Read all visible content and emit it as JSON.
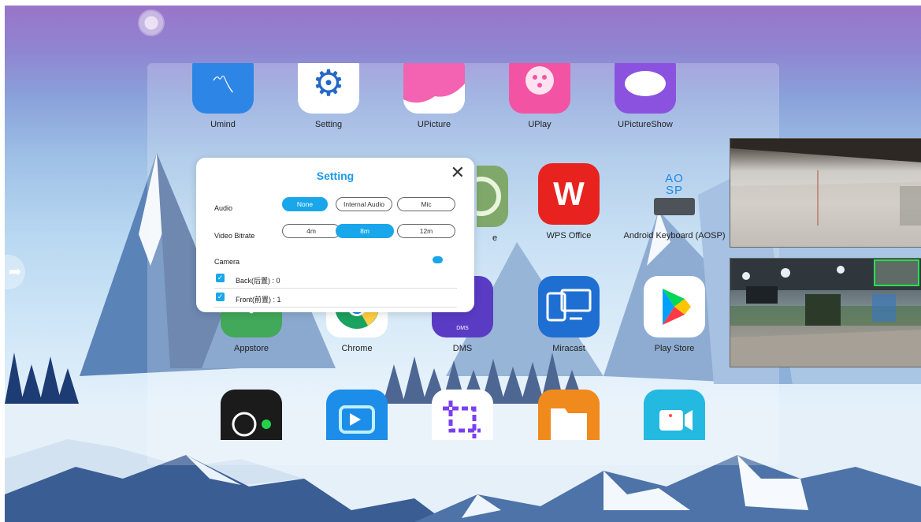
{
  "launcher": {
    "row1": [
      {
        "label": "Umind",
        "icon": "umind-icon",
        "color": "#2d86e6"
      },
      {
        "label": "Setting",
        "icon": "gear-icon",
        "color": "#2468c6"
      },
      {
        "label": "UPicture",
        "icon": "upicture-icon",
        "color": "#f462b2"
      },
      {
        "label": "UPlay",
        "icon": "uplay-icon",
        "color": "#f254a3"
      },
      {
        "label": "UPictureShow",
        "icon": "upictureshow-icon",
        "color": "#8b52e0"
      }
    ],
    "row2": [
      {
        "label": "WPS Office",
        "icon": "wps-office-icon",
        "color": "#e8231f"
      },
      {
        "label": "Android Keyboard (AOSP)",
        "icon": "keyboard-icon",
        "color": "#3a3f44"
      }
    ],
    "row2_partial_label": "e",
    "row3": [
      {
        "label": "Appstore",
        "icon": "appstore-icon",
        "color": "#42a85a"
      },
      {
        "label": "Chrome",
        "icon": "chrome-icon",
        "color": "#ffffff"
      },
      {
        "label": "DMS",
        "icon": "dms-icon",
        "color": "#5a3bc4",
        "sub": "DMS"
      },
      {
        "label": "Miracast",
        "icon": "miracast-icon",
        "color": "#1f6fd3"
      },
      {
        "label": "Play Store",
        "icon": "play-store-icon",
        "color": "#ffffff"
      }
    ],
    "row4": [
      {
        "label": "",
        "icon": "camera-app-icon",
        "color": "#1b1b1b"
      },
      {
        "label": "",
        "icon": "screen-recorder-icon",
        "color": "#1c8de8"
      },
      {
        "label": "",
        "icon": "crop-icon",
        "color": "#ffffff"
      },
      {
        "label": "",
        "icon": "folder-icon",
        "color": "#f08a1c"
      },
      {
        "label": "",
        "icon": "video-call-icon",
        "color": "#23b9e0"
      }
    ]
  },
  "dialog": {
    "title": "Setting",
    "close": "✕",
    "audio_label": "Audio",
    "audio_options": [
      "None",
      "Internal Audio",
      "Mic"
    ],
    "audio_selected": "None",
    "bitrate_label": "Video Bitrate",
    "bitrate_options": [
      "4m",
      "8m",
      "12m"
    ],
    "bitrate_selected": "8m",
    "camera_label": "Camera",
    "camera_enabled": true,
    "cameras": [
      {
        "label": "Back(后置) : 0",
        "checked": true
      },
      {
        "label": "Front(前置) : 1",
        "checked": true
      }
    ]
  },
  "accent": "#19a6ea"
}
